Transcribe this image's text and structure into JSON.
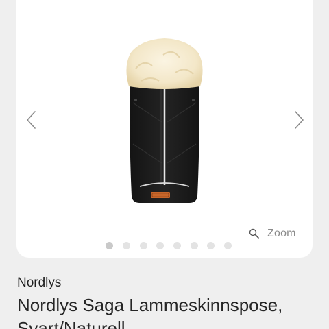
{
  "gallery": {
    "prev_icon": "chevron-left-icon",
    "next_icon": "chevron-right-icon",
    "zoom": {
      "icon": "magnifier-icon",
      "label": "Zoom"
    },
    "image_count": 8,
    "active_index": 0,
    "image_badge_text": "NORDLYS"
  },
  "product": {
    "brand": "Nordlys",
    "title": "Nordlys Saga Lammeskinnspose, Svart/Naturell"
  },
  "colors": {
    "background": "#efefef",
    "card": "#ffffff",
    "bag_body": "#1c1c1c",
    "fur": "#f3e7c8",
    "badge": "#c8662a",
    "dot_inactive": "#e3e3e3",
    "dot_active": "#c9c9c9"
  }
}
